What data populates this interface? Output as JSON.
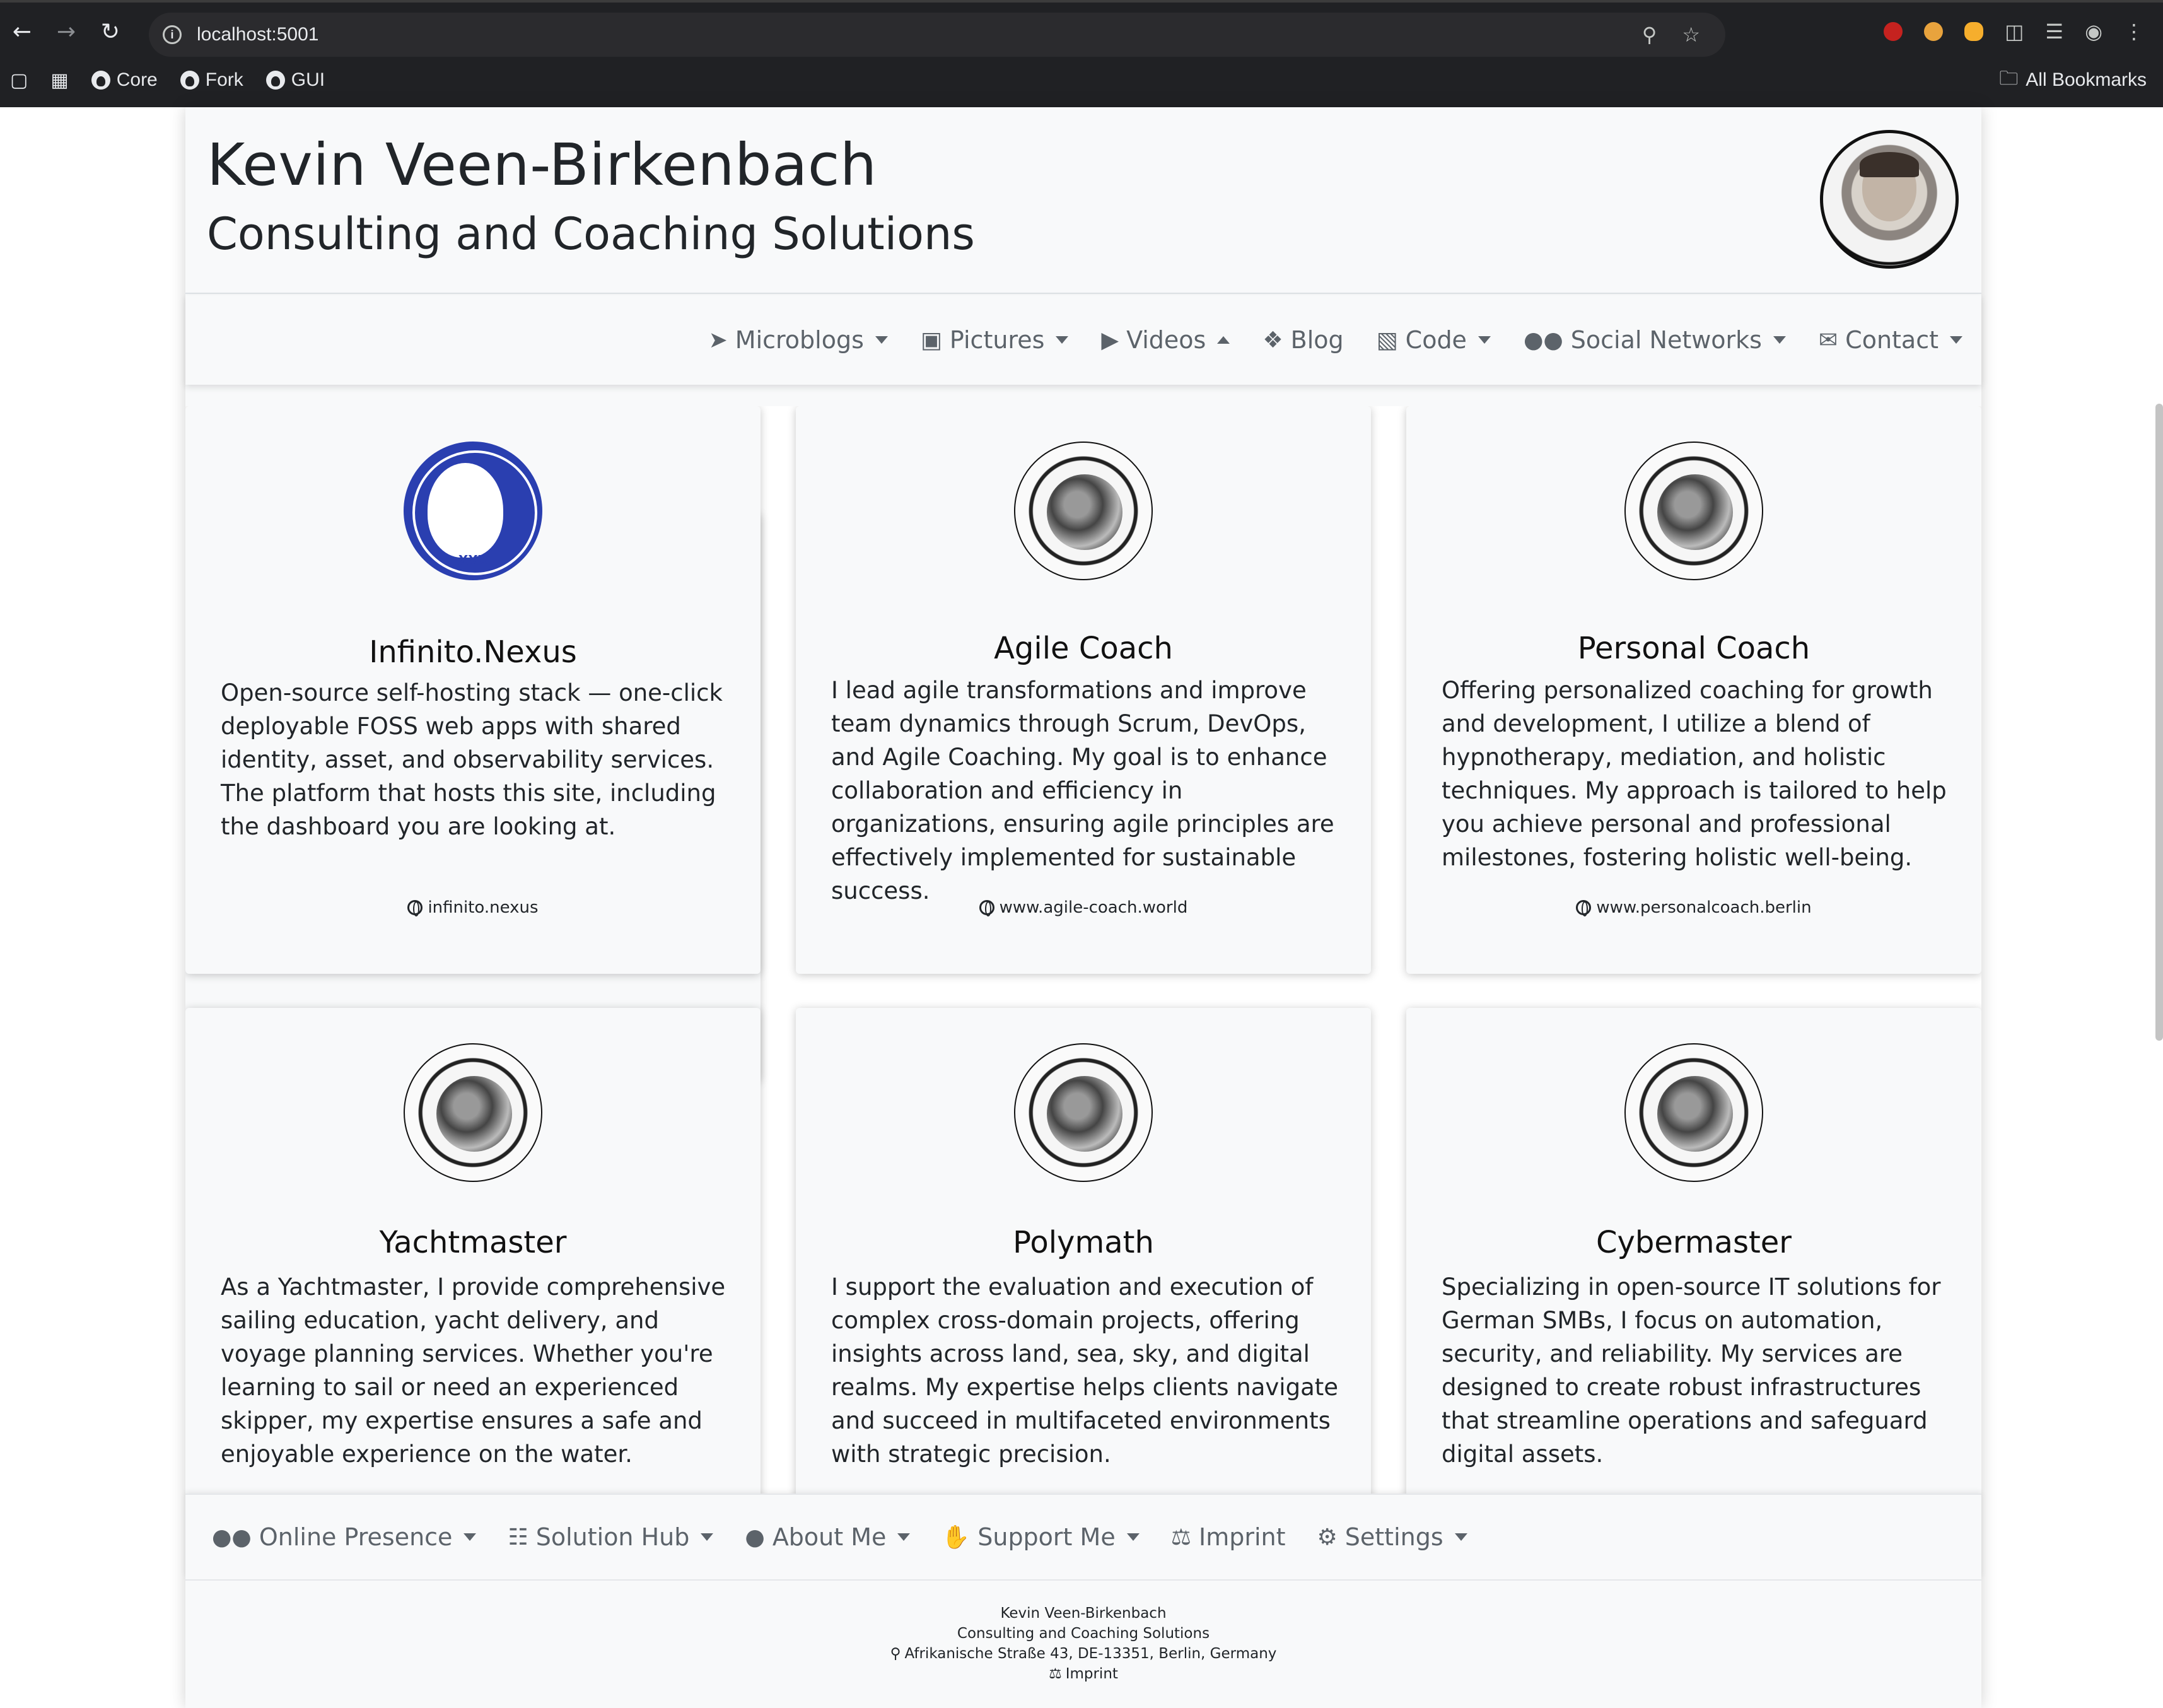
{
  "browser": {
    "url": "localhost:5001",
    "bookmarks": [
      {
        "label": "Core"
      },
      {
        "label": "Fork"
      },
      {
        "label": "GUI"
      }
    ],
    "all_bookmarks": "All Bookmarks"
  },
  "header": {
    "title": "Kevin Veen-Birkenbach",
    "subtitle": "Consulting and Coaching Solutions"
  },
  "topnav": [
    {
      "label": "Microblogs",
      "icon": "rocket-icon"
    },
    {
      "label": "Pictures",
      "icon": "images-icon"
    },
    {
      "label": "Videos",
      "icon": "video-icon"
    },
    {
      "label": "Blog",
      "icon": "blog-icon"
    },
    {
      "label": "Code",
      "icon": "laptop-code-icon"
    },
    {
      "label": "Social Networks",
      "icon": "users-icon"
    },
    {
      "label": "Contact",
      "icon": "envelope-icon"
    }
  ],
  "cards": [
    {
      "title": "Infinito.Nexus",
      "text": "Open-source self-hosting stack — one-click deployable FOSS web apps with shared identity, asset, and observability services. The platform that hosts this site, including the dashboard you are looking at.",
      "link": "infinito.nexus",
      "logo_text": "XXX"
    },
    {
      "title": "Agile Coach",
      "text": "I lead agile transformations and improve team dynamics through Scrum, DevOps, and Agile Coaching. My goal is to enhance collaboration and efficiency in organizations, ensuring agile principles are effectively implemented for sustainable success.",
      "link": "www.agile-coach.world"
    },
    {
      "title": "Personal Coach",
      "text": "Offering personalized coaching for growth and development, I utilize a blend of hypnotherapy, mediation, and holistic techniques. My approach is tailored to help you achieve personal and professional milestones, fostering holistic well-being.",
      "link": "www.personalcoach.berlin"
    },
    {
      "title": "Yachtmaster",
      "text": "As a Yachtmaster, I provide comprehensive sailing education, yacht delivery, and voyage planning services. Whether you're learning to sail or need an experienced skipper, my expertise ensures a safe and enjoyable experience on the water."
    },
    {
      "title": "Polymath",
      "text": "I support the evaluation and execution of complex cross-domain projects, offering insights across land, sea, sky, and digital realms. My expertise helps clients navigate and succeed in multifaceted environments with strategic precision."
    },
    {
      "title": "Cybermaster",
      "text": "Specializing in open-source IT solutions for German SMBs, I focus on automation, security, and reliability. My services are designed to create robust infrastructures that streamline operations and safeguard digital assets."
    }
  ],
  "bottomnav": [
    {
      "label": "Online Presence",
      "icon": "users-icon"
    },
    {
      "label": "Solution Hub",
      "icon": "sitemap-icon"
    },
    {
      "label": "About Me",
      "icon": "user-icon"
    },
    {
      "label": "Support Me",
      "icon": "hand-holding-icon"
    },
    {
      "label": "Imprint",
      "icon": "scale-icon"
    },
    {
      "label": "Settings",
      "icon": "gear-icon"
    }
  ],
  "footer": {
    "name": "Kevin Veen-Birkenbach",
    "tagline": "Consulting and Coaching Solutions",
    "address": "Afrikanische Straße 43, DE-13351, Berlin, Germany",
    "imprint": "Imprint"
  }
}
